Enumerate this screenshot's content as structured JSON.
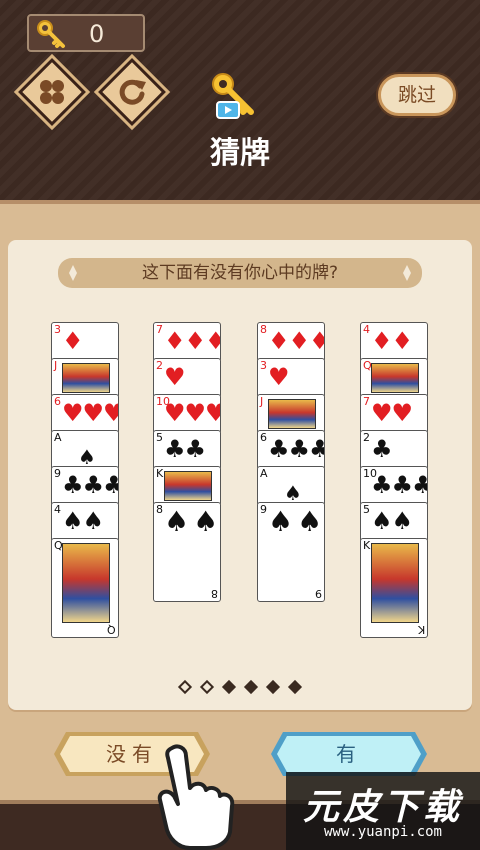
{
  "hud": {
    "key_count": "0"
  },
  "header": {
    "title": "猜牌",
    "skip_label": "跳过"
  },
  "question": "这下面有没有你心中的牌?",
  "columns": [
    {
      "cards": [
        {
          "rank": "3",
          "suit": "diamond",
          "pips": "♦"
        },
        {
          "rank": "J",
          "suit": "diamond",
          "pips": "",
          "face": true
        },
        {
          "rank": "6",
          "suit": "heart",
          "pips": "♥♥♥"
        },
        {
          "rank": "A",
          "suit": "spade",
          "pips": ""
        },
        {
          "rank": "9",
          "suit": "club",
          "pips": "♣♣♣"
        },
        {
          "rank": "4",
          "suit": "spade",
          "pips": "♠♠"
        },
        {
          "rank": "Q",
          "suit": "club",
          "pips": "",
          "face": true
        }
      ]
    },
    {
      "cards": [
        {
          "rank": "7",
          "suit": "diamond",
          "pips": "♦♦♦"
        },
        {
          "rank": "2",
          "suit": "heart",
          "pips": "♥"
        },
        {
          "rank": "10",
          "suit": "heart",
          "pips": "♥♥♥"
        },
        {
          "rank": "5",
          "suit": "club",
          "pips": "♣♣"
        },
        {
          "rank": "K",
          "suit": "club",
          "pips": "",
          "face": true
        },
        {
          "rank": "8",
          "suit": "spade",
          "pips": "♠♠"
        }
      ]
    },
    {
      "cards": [
        {
          "rank": "8",
          "suit": "diamond",
          "pips": "♦♦♦"
        },
        {
          "rank": "3",
          "suit": "heart",
          "pips": "♥"
        },
        {
          "rank": "J",
          "suit": "heart",
          "pips": "",
          "face": true
        },
        {
          "rank": "6",
          "suit": "club",
          "pips": "♣♣♣"
        },
        {
          "rank": "A",
          "suit": "spade",
          "pips": ""
        },
        {
          "rank": "9",
          "suit": "spade",
          "pips": "♠♠"
        }
      ]
    },
    {
      "cards": [
        {
          "rank": "4",
          "suit": "diamond",
          "pips": "♦♦"
        },
        {
          "rank": "Q",
          "suit": "heart",
          "pips": "",
          "face": true
        },
        {
          "rank": "7",
          "suit": "heart",
          "pips": "♥♥"
        },
        {
          "rank": "2",
          "suit": "club",
          "pips": "♣"
        },
        {
          "rank": "10",
          "suit": "club",
          "pips": "♣♣♣"
        },
        {
          "rank": "5",
          "suit": "spade",
          "pips": "♠♠"
        },
        {
          "rank": "K",
          "suit": "spade",
          "pips": "",
          "face": true
        }
      ]
    }
  ],
  "bottom_ranks": {
    "col2": "8",
    "col3": "6"
  },
  "pagination": {
    "total": 6,
    "current": 3
  },
  "buttons": {
    "no_label": "没有",
    "yes_label": "有"
  },
  "watermark": {
    "title": "元皮下载",
    "url": "www.yuanpi.com"
  },
  "colors": {
    "red_suit": "#e21e22",
    "black_suit": "#111111",
    "board": "#d9bb94",
    "header_bg": "#3e2a22"
  }
}
